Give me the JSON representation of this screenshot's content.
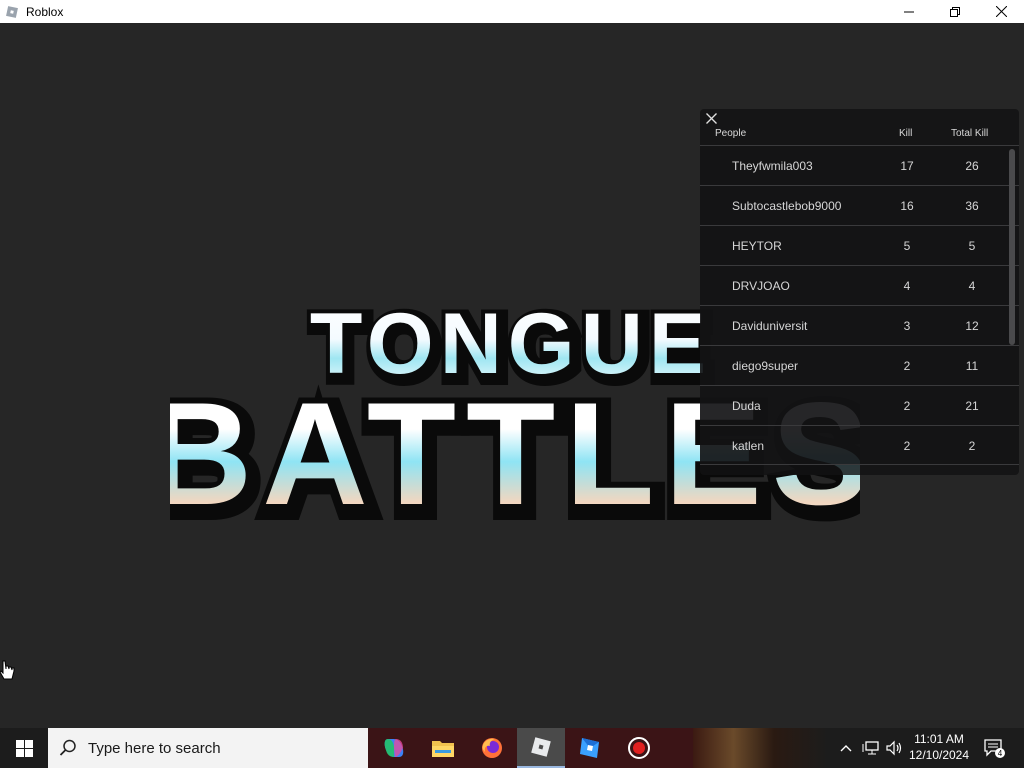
{
  "window": {
    "title": "Roblox",
    "controls": {
      "minimize": "minimize",
      "restore": "restore",
      "close": "close"
    }
  },
  "game": {
    "logo": {
      "line1": "TONGUE",
      "line2": "BATTLES"
    }
  },
  "leaderboard": {
    "columns": {
      "people": "People",
      "kill": "Kill",
      "total": "Total Kill"
    },
    "rows": [
      {
        "name": "Theyfwmila003",
        "kill": "17",
        "total": "26"
      },
      {
        "name": "Subtocastlebob9000",
        "kill": "16",
        "total": "36"
      },
      {
        "name": "HEYTOR",
        "kill": "5",
        "total": "5"
      },
      {
        "name": "DRVJOAO",
        "kill": "4",
        "total": "4"
      },
      {
        "name": "Daviduniversit",
        "kill": "3",
        "total": "12"
      },
      {
        "name": "diego9super",
        "kill": "2",
        "total": "11"
      },
      {
        "name": "Duda",
        "kill": "2",
        "total": "21"
      },
      {
        "name": "katlen",
        "kill": "2",
        "total": "2"
      }
    ]
  },
  "taskbar": {
    "search_placeholder": "Type here to search",
    "apps": [
      "copilot-icon",
      "file-explorer-icon",
      "firefox-icon",
      "roblox-icon",
      "roblox-studio-icon",
      "record-icon"
    ],
    "clock": {
      "time": "11:01 AM",
      "date": "12/10/2024"
    },
    "notifications_count": "4"
  }
}
